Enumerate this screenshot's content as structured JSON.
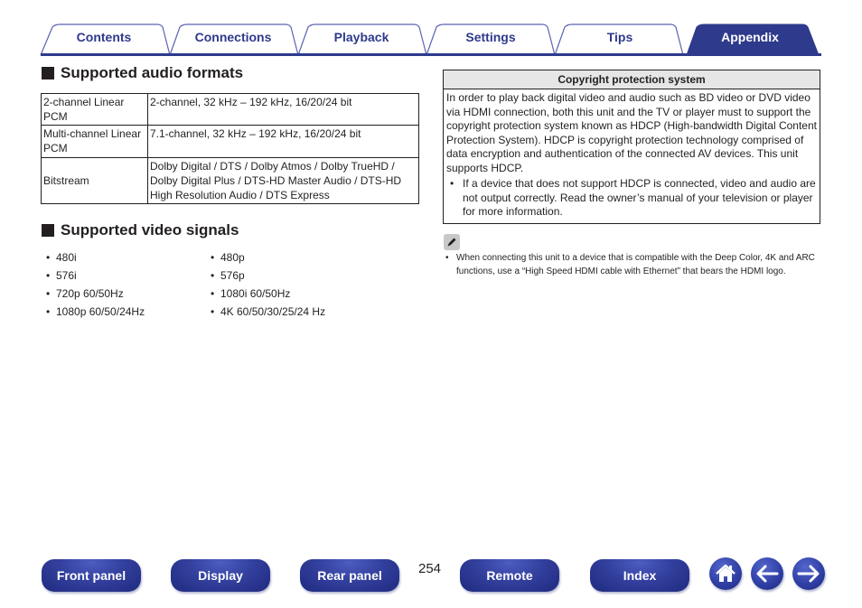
{
  "tabs": [
    {
      "label": "Contents",
      "active": false
    },
    {
      "label": "Connections",
      "active": false
    },
    {
      "label": "Playback",
      "active": false
    },
    {
      "label": "Settings",
      "active": false
    },
    {
      "label": "Tips",
      "active": false
    },
    {
      "label": "Appendix",
      "active": true
    }
  ],
  "colors": {
    "brand_blue": "#2e3a8c",
    "tab_line": "#2e3a8c",
    "table_header_bg": "#e6e6e6",
    "text": "#231f20"
  },
  "audio_section": {
    "title": "Supported audio formats",
    "rows": [
      {
        "format": "2-channel Linear PCM",
        "spec": "2-channel, 32 kHz – 192 kHz, 16/20/24 bit"
      },
      {
        "format": "Multi-channel Linear PCM",
        "spec": "7.1-channel, 32 kHz – 192 kHz, 16/20/24 bit"
      },
      {
        "format": "Bitstream",
        "spec": "Dolby Digital / DTS / Dolby Atmos / Dolby TrueHD / Dolby Digital Plus / DTS-HD Master Audio / DTS-HD High Resolution Audio / DTS Express"
      }
    ]
  },
  "video_section": {
    "title": "Supported video signals",
    "col1": [
      "480i",
      "576i",
      "720p 60/50Hz",
      "1080p 60/50/24Hz"
    ],
    "col2": [
      "480p",
      "576p",
      "1080i 60/50Hz",
      "4K 60/50/30/25/24 Hz"
    ]
  },
  "copyright": {
    "title": "Copyright protection system",
    "body": "In order to play back digital video and audio such as BD video or DVD video via HDMI connection, both this unit and the TV or player must to support the copyright protection system known as HDCP (High-bandwidth Digital Content Protection System). HDCP is copyright protection technology comprised of data encryption and authentication of the connected AV devices. This unit supports HDCP.",
    "bullet": "If a device that does not support HDCP is connected, video and audio are not output correctly. Read the owner’s manual of your television or player for more information."
  },
  "note": {
    "icon": "pencil-icon",
    "text": "When connecting this unit to a device that is compatible with the Deep Color, 4K and ARC functions, use a “High Speed HDMI cable with Ethernet” that bears the HDMI logo."
  },
  "bottom_nav": {
    "buttons": [
      "Front panel",
      "Display",
      "Rear panel",
      "Remote",
      "Index"
    ],
    "page_number": "254",
    "icons": [
      "home-icon",
      "back-arrow-icon",
      "forward-arrow-icon"
    ]
  },
  "bullet_char": "•"
}
